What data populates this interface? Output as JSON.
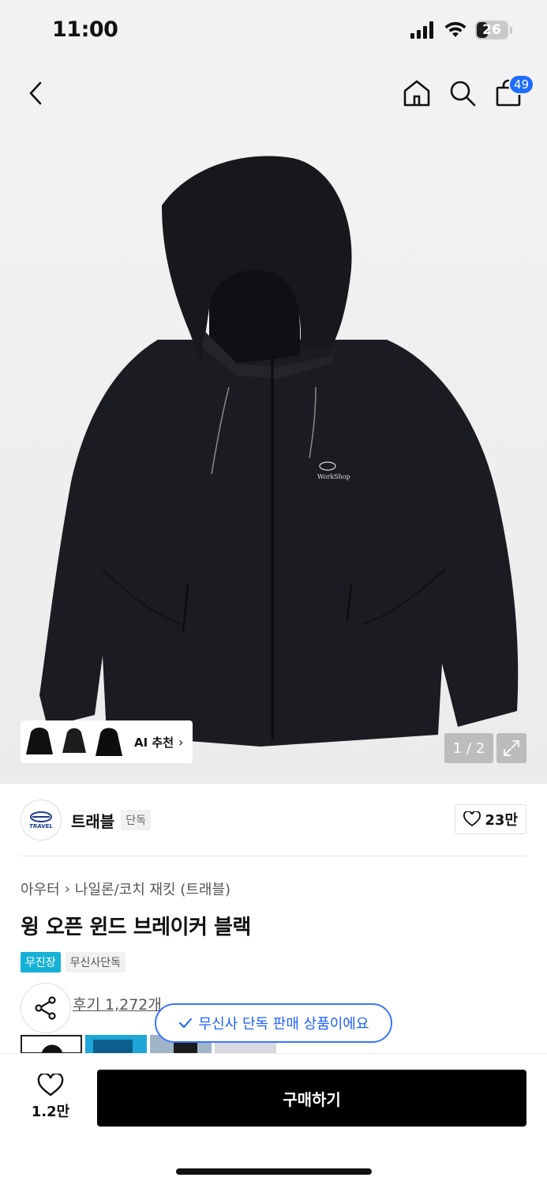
{
  "status": {
    "time": "11:00",
    "battery": "26"
  },
  "nav": {
    "cart_count": "49"
  },
  "gallery": {
    "ai_label": "AI 추천",
    "page": "1 / 2",
    "logo_text": "WorkShop"
  },
  "brand": {
    "logo_text": "TRAVEL",
    "name": "트래블",
    "tag": "단독",
    "likes": "23만"
  },
  "breadcrumb": {
    "category": "아우터",
    "subcategory": "나일론/코치 재킷 (트래블)"
  },
  "product": {
    "title": "윙 오픈 윈드 브레이커 블랙"
  },
  "badges": [
    "무진장",
    "무신사단독"
  ],
  "reviews": {
    "label": "후기 1,272개"
  },
  "toast": {
    "text": "무신사 단독 판매 상품이에요"
  },
  "bottom": {
    "fav_count": "1.2만",
    "buy_label": "구매하기"
  },
  "colors": {
    "accent_blue": "#1d6cff",
    "badge_blue": "#16b1d6",
    "buy_black": "#000000"
  }
}
